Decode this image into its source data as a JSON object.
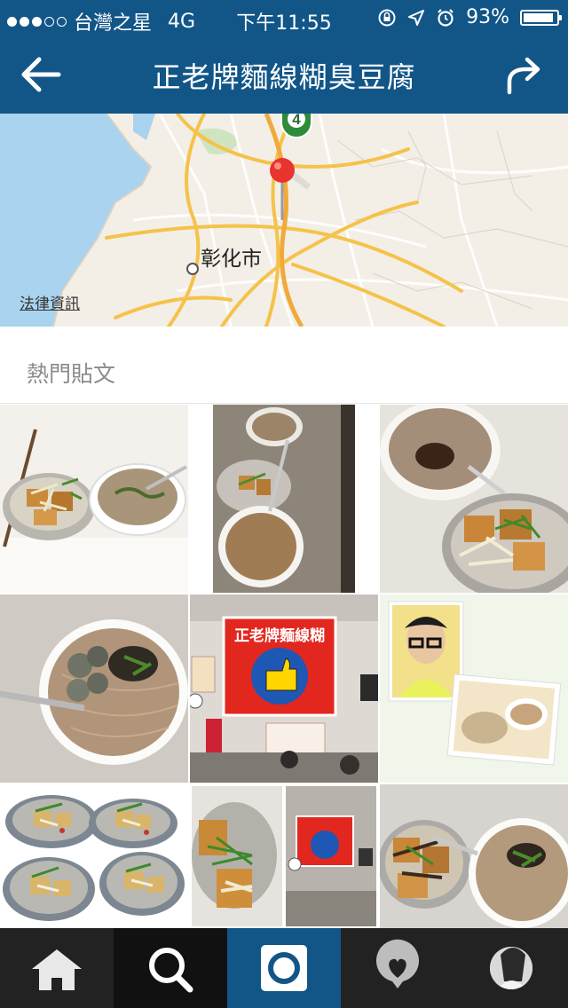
{
  "status_bar": {
    "carrier": "台灣之星",
    "network": "4G",
    "time": "下午11:55",
    "battery": "93%",
    "battery_level": 0.93,
    "signal_bars": 3,
    "signal_total": 5
  },
  "nav": {
    "title": "正老牌麵線糊臭豆腐"
  },
  "map": {
    "route_number": "4",
    "city_label": "彰化市",
    "legal_link": "法律資訊"
  },
  "section": {
    "title": "熱門貼文"
  },
  "photo_sign": {
    "text": "正老牌麵線糊"
  },
  "tabs": [
    {
      "name": "home"
    },
    {
      "name": "search"
    },
    {
      "name": "camera"
    },
    {
      "name": "activity"
    },
    {
      "name": "profile"
    }
  ],
  "colors": {
    "brand": "#125688",
    "tabbar": "#222222",
    "map_pin": "#e8332e",
    "map_road": "#f5c24a",
    "map_water": "#a9d3ee"
  }
}
